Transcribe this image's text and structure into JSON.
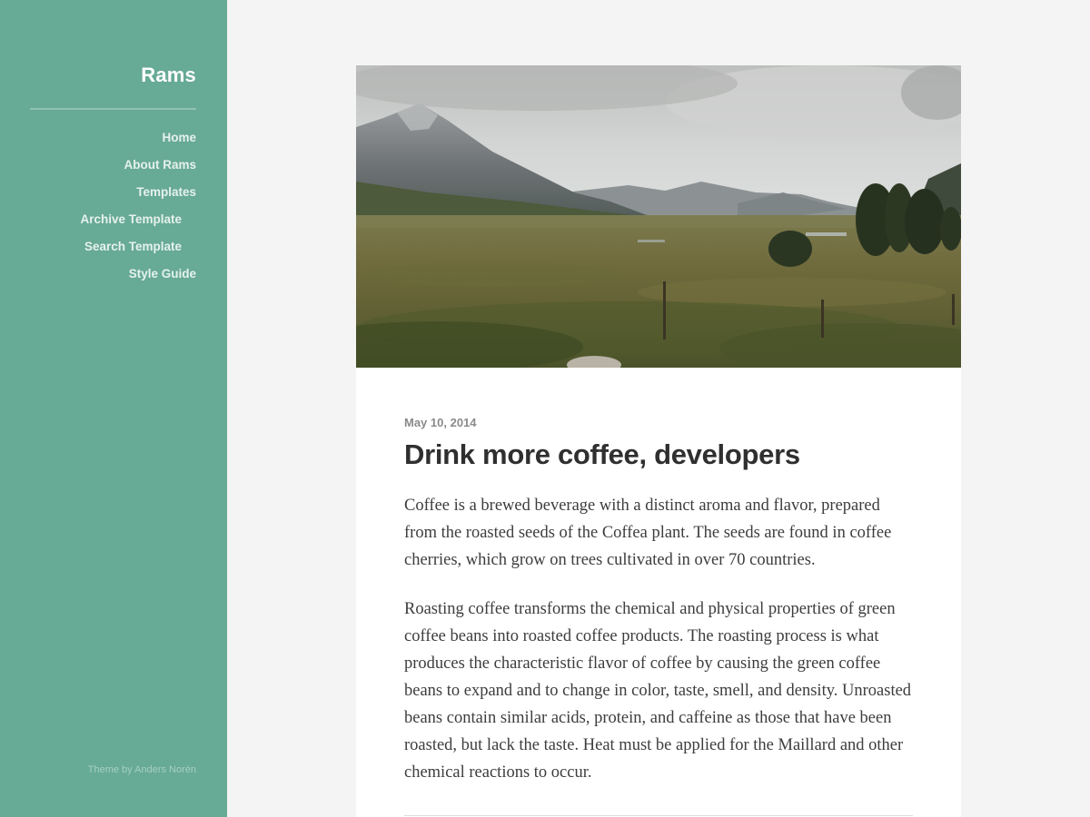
{
  "site": {
    "title": "Rams"
  },
  "nav": {
    "items": [
      {
        "label": "Home"
      },
      {
        "label": "About Rams"
      },
      {
        "label": "Templates"
      },
      {
        "label": "Archive Template"
      },
      {
        "label": "Search Template"
      },
      {
        "label": "Style Guide"
      }
    ]
  },
  "footer": {
    "credit": "Theme by Anders Norén"
  },
  "post": {
    "image": {
      "subject": "mountain valley landscape with meadow, pine trees and fence posts"
    },
    "date": "May 10, 2014",
    "title": "Drink more coffee, developers",
    "paragraphs": [
      "Coffee is a brewed beverage with a distinct aroma and flavor, prepared from the roasted seeds of the Coffea plant. The seeds are found in coffee cherries, which grow on trees cultivated in over 70 countries.",
      "Roasting coffee transforms the chemical and physical properties of green coffee beans into roasted coffee products. The roasting process is what produces the characteristic flavor of coffee by causing the green coffee beans to expand and to change in color, taste, smell, and density. Unroasted beans contain similar acids, protein, and caffeine as those that have been roasted, but lack the taste. Heat must be applied for the Maillard and other chemical reactions to occur."
    ]
  },
  "colors": {
    "sidebar": "#67aa95",
    "page_background": "#f4f4f4",
    "card_background": "#ffffff",
    "title_text": "#2f2f2f",
    "body_text": "#3d3d3d",
    "date_text": "#8a8a8a"
  }
}
